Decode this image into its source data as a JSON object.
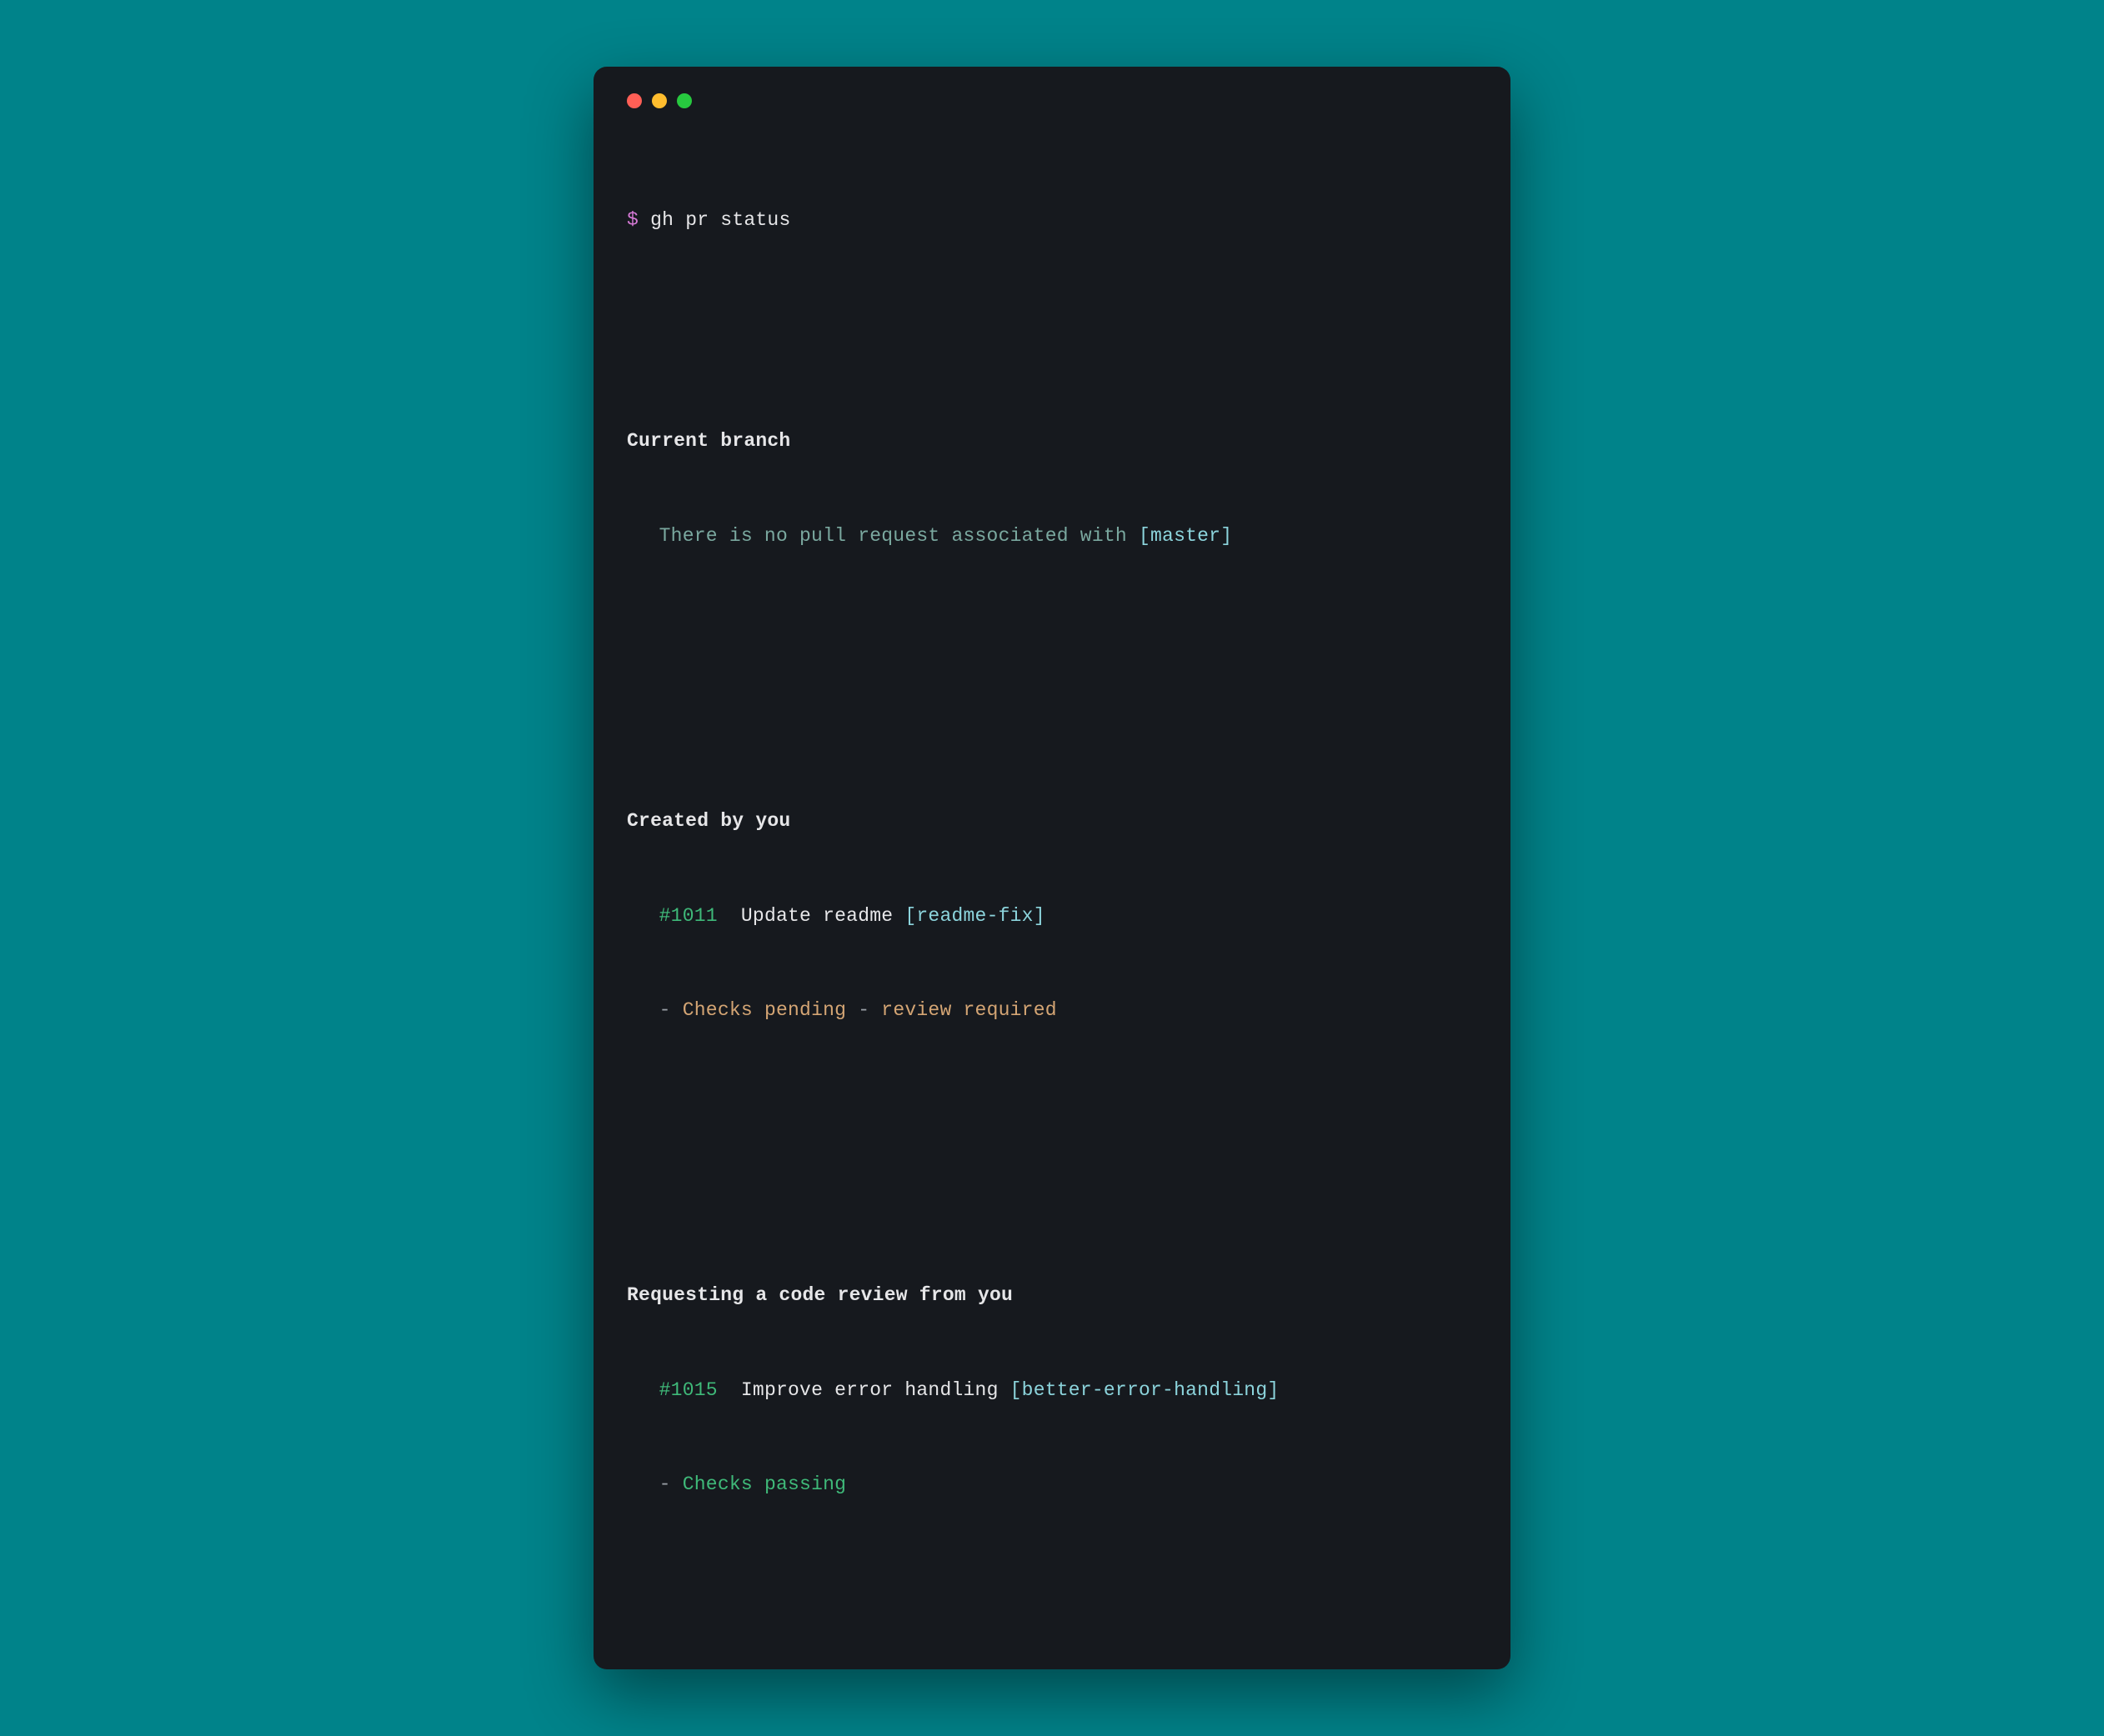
{
  "prompt": {
    "symbol": "$",
    "command": "gh pr status"
  },
  "sections": {
    "current_branch": {
      "header": "Current branch",
      "message": "There is no pull request associated with ",
      "branch": "[master]"
    },
    "created_by_you": {
      "header": "Created by you",
      "pr_number": "#1011",
      "pr_title": "Update readme ",
      "pr_branch": "[readme-fix]",
      "status_checks": "Checks pending",
      "status_review": "review required"
    },
    "requesting_review": {
      "header": "Requesting a code review from you",
      "pr_number": "#1015",
      "pr_title": "Improve error handling ",
      "pr_branch": "[better-error-handling]",
      "status_checks": "Checks passing"
    }
  },
  "colors": {
    "background": "#00838a",
    "terminal_bg": "#16191e",
    "prompt": "#d67ad6",
    "green": "#3fb979",
    "cyan": "#8cd4dc",
    "muted": "#7aa89f",
    "orange": "#d4a574"
  }
}
